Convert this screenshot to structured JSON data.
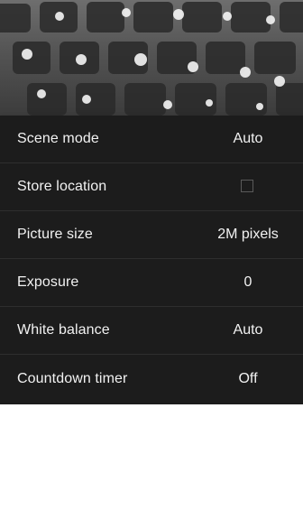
{
  "preview": {
    "icon": "camera-viewfinder"
  },
  "settings": {
    "rows": [
      {
        "label": "Scene mode",
        "value": "Auto"
      },
      {
        "label": "Store location",
        "value": "",
        "checked": false
      },
      {
        "label": "Picture size",
        "value": "2M pixels"
      },
      {
        "label": "Exposure",
        "value": "0"
      },
      {
        "label": "White balance",
        "value": "Auto"
      },
      {
        "label": "Countdown timer",
        "value": "Off"
      }
    ]
  },
  "colors": {
    "panel_bg": "#1c1c1c",
    "text": "#f2f2f2",
    "divider": "#2e2e2e"
  }
}
